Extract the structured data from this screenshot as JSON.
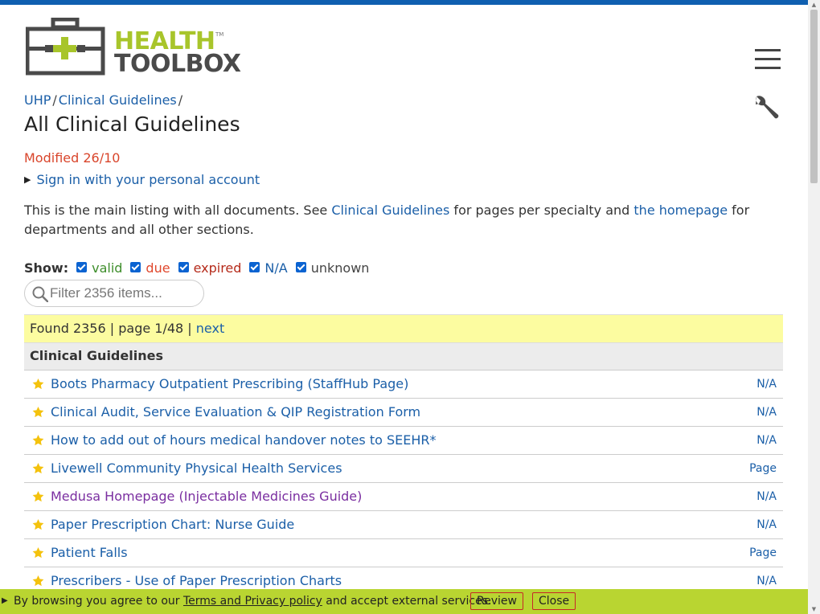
{
  "logo": {
    "line1": "HEALTH",
    "line2": "TOOLBOX",
    "tm": "TM"
  },
  "breadcrumb": [
    {
      "label": "UHP"
    },
    {
      "label": "Clinical Guidelines"
    }
  ],
  "breadcrumb_sep": "/",
  "page_title": "All Clinical Guidelines",
  "modified": "Modified 26/10",
  "signin": {
    "arrow": "▶",
    "label": "Sign in with your personal account"
  },
  "intro": {
    "text1": "This is the main listing with all documents. See ",
    "link1": "Clinical Guidelines",
    "text2": " for pages per specialty and ",
    "link2": "the homepage",
    "text3": " for departments and all other sections."
  },
  "show": {
    "label": "Show:",
    "options": [
      {
        "label": "valid",
        "checked": true
      },
      {
        "label": "due",
        "checked": true
      },
      {
        "label": "expired",
        "checked": true
      },
      {
        "label": "N/A",
        "checked": true
      },
      {
        "label": "unknown",
        "checked": true
      }
    ]
  },
  "filter": {
    "placeholder": "Filter 2356 items..."
  },
  "found": {
    "text": "Found 2356 | page 1/48 | ",
    "next": "next"
  },
  "section": "Clinical Guidelines",
  "items": [
    {
      "title": "Boots Pharmacy Outpatient Prescribing (StaffHub Page)",
      "status": "N/A"
    },
    {
      "title": "Clinical Audit, Service Evaluation & QIP Registration Form",
      "status": "N/A"
    },
    {
      "title": "How to add out of hours medical handover notes to SEEHR*",
      "status": "N/A"
    },
    {
      "title": "Livewell Community Physical Health Services",
      "status": "Page"
    },
    {
      "title": "Medusa Homepage (Injectable Medicines Guide)",
      "status": "N/A",
      "visited": true
    },
    {
      "title": "Paper Prescription Chart: Nurse Guide",
      "status": "N/A"
    },
    {
      "title": "Patient Falls",
      "status": "Page"
    },
    {
      "title": "Prescribers - Use of Paper Prescription Charts",
      "status": "N/A"
    }
  ],
  "cookie": {
    "arrow": "▶",
    "text1": "By browsing you agree to our ",
    "link": "Terms and Privacy policy",
    "text2": " and accept external services.",
    "review": "Review",
    "close": "Close"
  },
  "colors": {
    "brand_green": "#a8c52b",
    "link_blue": "#1b5fa8",
    "top_bar": "#0f5fb0",
    "found_bg": "#fcfca0",
    "cookie_bg": "#b9d531"
  }
}
